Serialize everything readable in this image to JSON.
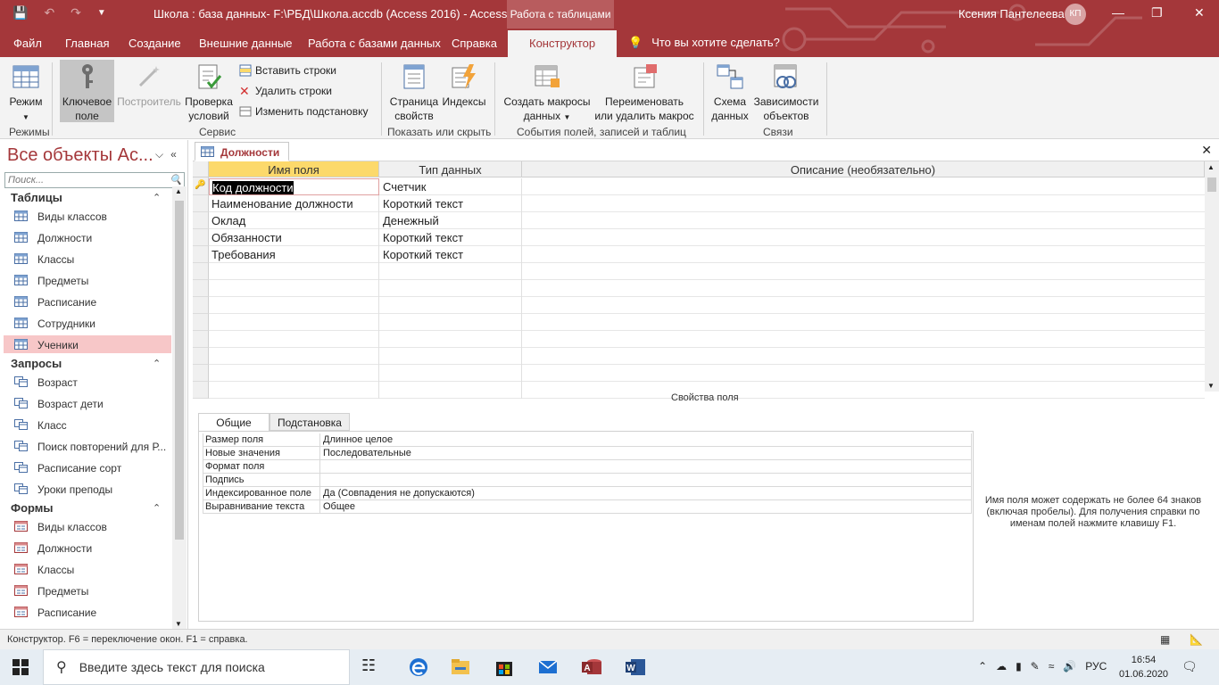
{
  "titlebar": {
    "title": "Школа : база данных- F:\\РБД\\Школа.accdb (Access 2016)  -  Access",
    "context_tab": "Работа с таблицами",
    "user": "Ксения Пантелеева",
    "avatar": "КП"
  },
  "menu": {
    "tabs": [
      "Файл",
      "Главная",
      "Создание",
      "Внешние данные",
      "Работа с базами данных",
      "Справка",
      "Конструктор"
    ],
    "active": "Конструктор",
    "tell_me": "Что вы хотите сделать?"
  },
  "ribbon": {
    "mode": "Режим",
    "primary_key": [
      "Ключевое",
      "поле"
    ],
    "builder": "Построитель",
    "test_rules": [
      "Проверка",
      "условий"
    ],
    "insert_rows": "Вставить строки",
    "delete_rows": "Удалить строки",
    "modify_lookups": "Изменить подстановку",
    "property_sheet": [
      "Страница",
      "свойств"
    ],
    "indexes": "Индексы",
    "create_macros": [
      "Создать макросы",
      "данных"
    ],
    "rename_macro": [
      "Переименовать",
      "или удалить макрос"
    ],
    "relationships": [
      "Схема",
      "данных"
    ],
    "dependencies": [
      "Зависимости",
      "объектов"
    ],
    "groups": {
      "modes": "Режимы",
      "tools": "Сервис",
      "show_hide": "Показать или скрыть",
      "events": "События полей, записей и таблиц",
      "relations": "Связи"
    }
  },
  "nav": {
    "title": "Все объекты Ac...",
    "search_placeholder": "Поиск...",
    "groups": {
      "tables": {
        "label": "Таблицы",
        "items": [
          "Виды классов",
          "Должности",
          "Классы",
          "Предметы",
          "Расписание",
          "Сотрудники",
          "Ученики"
        ]
      },
      "queries": {
        "label": "Запросы",
        "items": [
          "Возраст",
          "Возраст дети",
          "Класс",
          "Поиск повторений для Р...",
          "Расписание сорт",
          "Уроки преподы"
        ]
      },
      "forms": {
        "label": "Формы",
        "items": [
          "Виды классов",
          "Должности",
          "Классы",
          "Предметы",
          "Расписание"
        ]
      }
    }
  },
  "document": {
    "tab": "Должности",
    "headers": [
      "Имя поля",
      "Тип данных",
      "Описание (необязательно)"
    ],
    "rows": [
      {
        "name": "Код должности",
        "type": "Счетчик"
      },
      {
        "name": "Наименование должности",
        "type": "Короткий текст"
      },
      {
        "name": "Оклад",
        "type": "Денежный"
      },
      {
        "name": "Обязанности",
        "type": "Короткий текст"
      },
      {
        "name": "Требования",
        "type": "Короткий текст"
      }
    ]
  },
  "properties": {
    "caption": "Свойства поля",
    "tabs": [
      "Общие",
      "Подстановка"
    ],
    "rows": [
      {
        "label": "Размер поля",
        "value": "Длинное целое"
      },
      {
        "label": "Новые значения",
        "value": "Последовательные"
      },
      {
        "label": "Формат поля",
        "value": ""
      },
      {
        "label": "Подпись",
        "value": ""
      },
      {
        "label": "Индексированное поле",
        "value": "Да (Совпадения не допускаются)"
      },
      {
        "label": "Выравнивание текста",
        "value": "Общее"
      }
    ],
    "help": "Имя поля может содержать не более 64 знаков (включая пробелы). Для получения справки по именам полей нажмите клавишу F1."
  },
  "status": {
    "text": "Конструктор.  F6 = переключение окон.  F1 = справка."
  },
  "taskbar": {
    "search_placeholder": "Введите здесь текст для поиска",
    "lang": "РУС",
    "time": "16:54",
    "date": "01.06.2020"
  },
  "colors": {
    "accent": "#a4373a",
    "header_selected": "#fcd96b",
    "nav_selected": "#f7c7c8"
  }
}
